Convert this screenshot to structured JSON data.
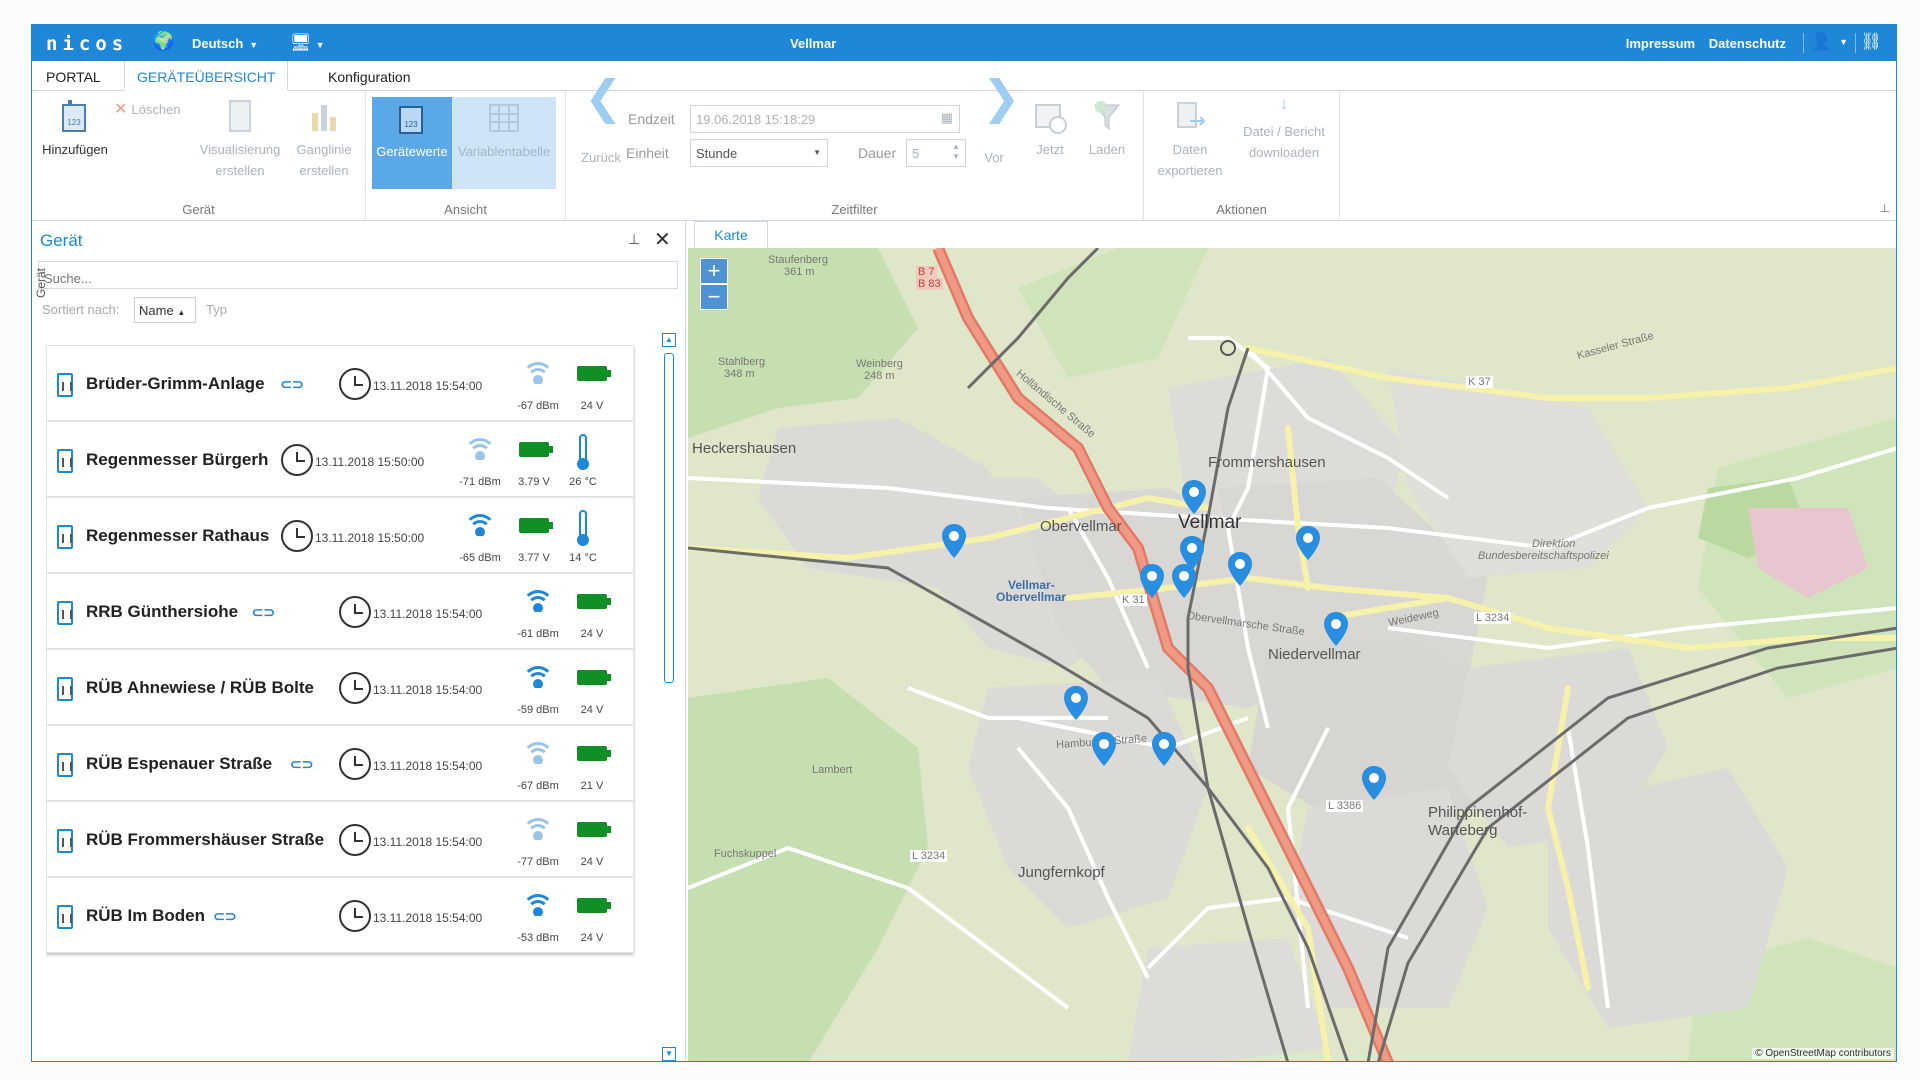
{
  "app": {
    "logo": "nicos",
    "language": "Deutsch",
    "window_title": "Vellmar",
    "links": [
      "Impressum",
      "Datenschutz"
    ]
  },
  "tabs": [
    {
      "label": "PORTAL",
      "active": false
    },
    {
      "label": "GERÄTEÜBERSICHT",
      "active": true
    },
    {
      "label": "Konfiguration",
      "active": false
    }
  ],
  "ribbon": {
    "geraet": {
      "title": "Gerät",
      "add": "Hinzufügen",
      "delete": "Löschen",
      "visualize": [
        "Visualisierung",
        "erstellen"
      ],
      "hydrograph": [
        "Ganglinie",
        "erstellen"
      ]
    },
    "ansicht": {
      "title": "Ansicht",
      "values": "Gerätewerte",
      "vartable": "Variablentabelle"
    },
    "zeitfilter": {
      "title": "Zeitfilter",
      "back": "Zurück",
      "endtime_label": "Endzeit",
      "unit_label": "Einheit",
      "endtime_value": "19.06.2018 15:18:29",
      "unit_value": "Stunde",
      "duration_label": "Dauer",
      "duration_value": "5",
      "next": "Vor",
      "now": "Jetzt",
      "load": "Laden"
    },
    "aktionen": {
      "title": "Aktionen",
      "export": [
        "Daten",
        "exportieren"
      ],
      "download": [
        "Datei / Bericht",
        "downloaden"
      ]
    }
  },
  "side_tab": "Gerät",
  "panel": {
    "title": "Gerät",
    "search_placeholder": "Suche...",
    "sort_label": "Sortiert nach:",
    "sort_value": "Name",
    "sort_other": "Typ"
  },
  "devices": [
    {
      "name": "Brüder-Grimm-Anlage",
      "link": true,
      "timestamp": "13.11.2018 15:54:00",
      "signal": "-67 dBm",
      "voltage": "24 V",
      "temp": null,
      "wifi": "weak"
    },
    {
      "name": "Regenmesser Bürgerh",
      "link": false,
      "timestamp": "13.11.2018 15:50:00",
      "signal": "-71 dBm",
      "voltage": "3.79 V",
      "temp": "26 °C",
      "wifi": "weak"
    },
    {
      "name": "Regenmesser Rathaus",
      "link": false,
      "timestamp": "13.11.2018 15:50:00",
      "signal": "-65 dBm",
      "voltage": "3.77 V",
      "temp": "14 °C",
      "wifi": "strong"
    },
    {
      "name": "RRB Günthersiohe",
      "link": true,
      "timestamp": "13.11.2018 15:54:00",
      "signal": "-61 dBm",
      "voltage": "24 V",
      "temp": null,
      "wifi": "strong"
    },
    {
      "name": "RÜB Ahnewiese / RÜB Bolte",
      "link": false,
      "timestamp": "13.11.2018 15:54:00",
      "signal": "-59 dBm",
      "voltage": "24 V",
      "temp": null,
      "wifi": "strong"
    },
    {
      "name": "RÜB Espenauer Straße",
      "link": true,
      "timestamp": "13.11.2018 15:54:00",
      "signal": "-67 dBm",
      "voltage": "21 V",
      "temp": null,
      "wifi": "weak"
    },
    {
      "name": "RÜB Frommershäuser Straße",
      "link": false,
      "timestamp": "13.11.2018 15:54:00",
      "signal": "-77 dBm",
      "voltage": "24 V",
      "temp": null,
      "wifi": "weak"
    },
    {
      "name": "RÜB Im Boden",
      "link": true,
      "timestamp": "13.11.2018 15:54:00",
      "signal": "-53 dBm",
      "voltage": "24 V",
      "temp": null,
      "wifi": "strong"
    }
  ],
  "map": {
    "tab": "Karte",
    "zoom_in": "+",
    "zoom_out": "−",
    "credits": "© OpenStreetMap contributors",
    "labels": {
      "vellmar": "Vellmar",
      "obervellmar": "Obervellmar",
      "niedervellmar": "Niedervellmar",
      "frommershausen": "Frommershausen",
      "heckershausen": "Heckershausen",
      "jungfernkopf": "Jungfernkopf",
      "philippinenhof": "Philippinenhof-",
      "warteberg": "Warteberg",
      "staufenberg": "Staufenberg",
      "staufenberg_h": "361 m",
      "weinberg": "Weinberg",
      "weinberg_h": "248 m",
      "stahlberg": "Stahlberg",
      "stahlberg_h": "348 m",
      "station": "Vellmar-",
      "station2": "Obervellmar",
      "b7": "B 7",
      "b83": "B 83",
      "k37": "K 37",
      "k31": "K 31",
      "l3234": "L 3234",
      "l3234b": "L 3234",
      "l3386": "L 3386",
      "kasseler": "Kasseler Straße",
      "hollaendische": "Holländische Straße",
      "obervellmarsche": "Obervellmarsche Straße",
      "weideweg": "Weideweg",
      "hamburger": "Hamburger Straße",
      "lambert": "Lambert",
      "fuchskuppel": "Fuchskuppel",
      "direktion": "Direktion",
      "bundes": "Bundesbereitschaftspolizei"
    }
  }
}
